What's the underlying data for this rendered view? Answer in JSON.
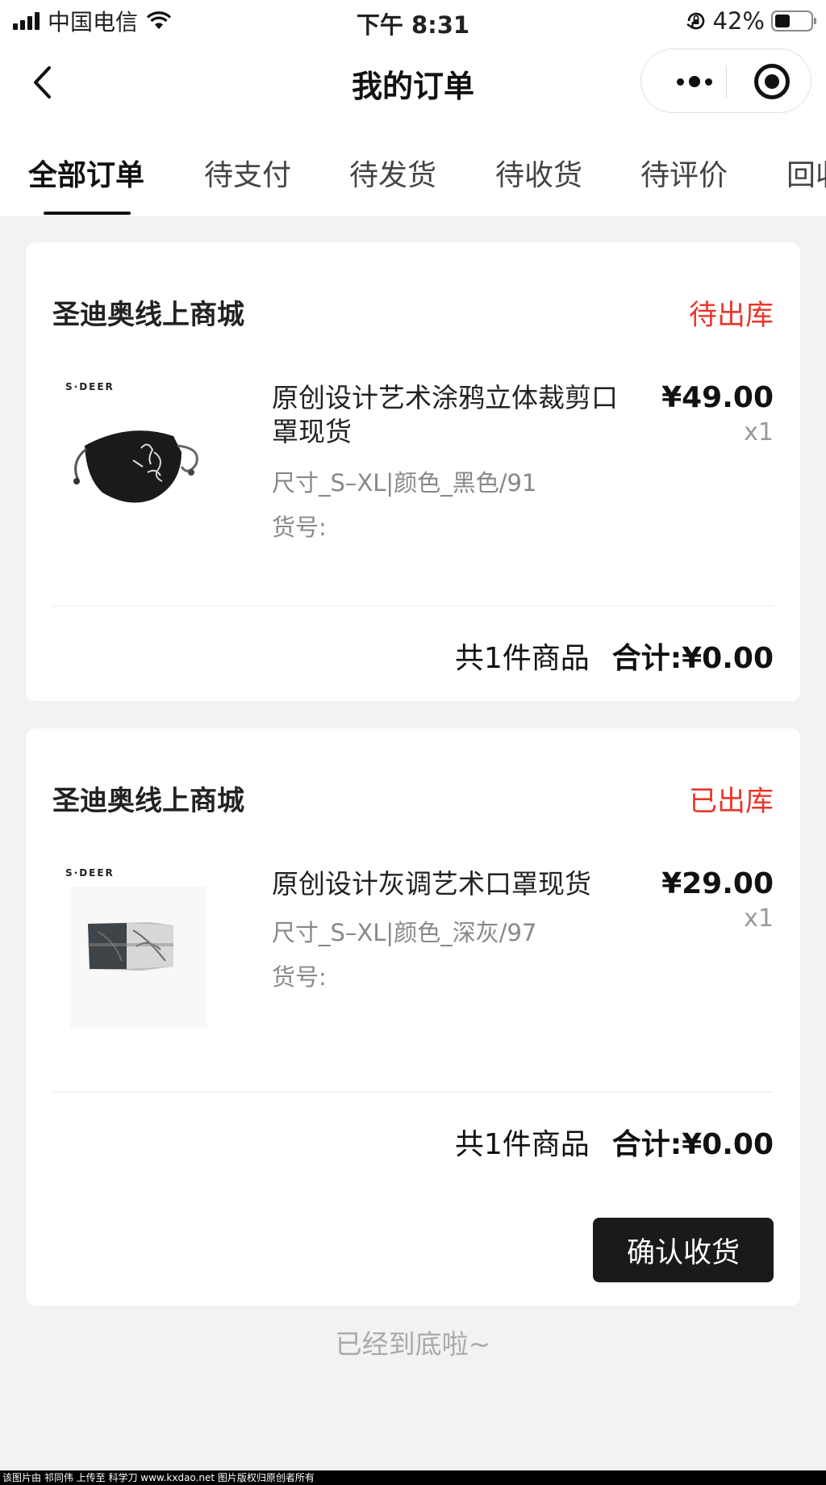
{
  "status_bar": {
    "carrier": "中国电信",
    "time": "下午 8:31",
    "battery": "42%",
    "battery_level": 0.42,
    "icons": [
      "signal-icon",
      "wifi-icon",
      "orientation-lock-icon",
      "battery-icon"
    ]
  },
  "nav": {
    "title": "我的订单",
    "back_icon": "chevron-left-icon",
    "more_icon": "more-dots-icon",
    "close_icon": "target-circle-icon"
  },
  "tabs": [
    {
      "label": "全部订单",
      "active": true
    },
    {
      "label": "待支付"
    },
    {
      "label": "待发货"
    },
    {
      "label": "待收货"
    },
    {
      "label": "待评价"
    },
    {
      "label": "回收"
    }
  ],
  "orders": [
    {
      "shop": "圣迪奥线上商城",
      "status": "待出库",
      "brand": "S·DEER",
      "title": "原创设计艺术涂鸦立体裁剪口罩现货",
      "price": "¥49.00",
      "qty": "x1",
      "spec": "尺寸_S–XL|颜色_黑色/91",
      "sku": "货号:",
      "count_text": "共1件商品",
      "total_text": "合计:¥0.00"
    },
    {
      "shop": "圣迪奥线上商城",
      "status": "已出库",
      "brand": "S·DEER",
      "title": "原创设计灰调艺术口罩现货",
      "price": "¥29.00",
      "qty": "x1",
      "spec": "尺寸_S–XL|颜色_深灰/97",
      "sku": "货号:",
      "count_text": "共1件商品",
      "total_text": "合计:¥0.00",
      "action": "确认收货"
    }
  ],
  "colors": {
    "accent_red": "#e8372c",
    "button_dark": "#1a1a1a",
    "bg": "#f2f2f2"
  },
  "end_text": "已经到底啦~",
  "watermark": "该图片由 祁同伟 上传至 科学刀 www.kxdao.net 图片版权归原创者所有"
}
